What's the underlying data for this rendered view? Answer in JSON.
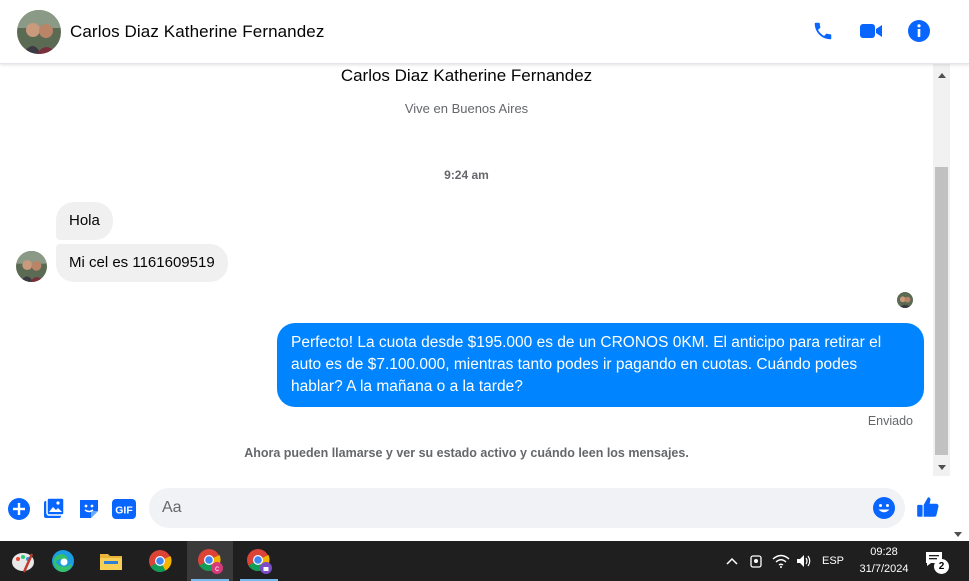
{
  "header": {
    "title": "Carlos Diaz Katherine Fernandez"
  },
  "profile": {
    "name": "Carlos Diaz Katherine Fernandez",
    "subtitle": "Vive en Buenos Aires"
  },
  "conversation": {
    "timestamp": "9:24 am",
    "incoming": [
      "Hola",
      "Mi cel es 1161609519"
    ],
    "outgoing": "Perfecto! La cuota desde $195.000 es de un CRONOS 0KM. El anticipo para retirar el auto es de $7.100.000, mientras tanto podes ir pagando en cuotas. Cuándo podes hablar? A la mañana o a la tarde?",
    "sent_status": "Enviado",
    "info": "Ahora pueden llamarse y ver su estado activo y cuándo leen los mensajes."
  },
  "composer": {
    "placeholder": "Aa",
    "gif_label": "GIF"
  },
  "taskbar": {
    "language": "ESP",
    "time": "09:28",
    "date": "31/7/2024",
    "notification_count": "2"
  },
  "colors": {
    "accent": "#0084ff",
    "messenger_icon": "#0866ff",
    "incoming_bubble": "#f0f0f0",
    "taskbar": "#1f1f1f"
  },
  "icons": [
    "phone-icon",
    "video-icon",
    "info-icon",
    "plus-icon",
    "image-icon",
    "sticker-icon",
    "gif-icon",
    "emoji-icon",
    "thumbs-up-icon"
  ]
}
